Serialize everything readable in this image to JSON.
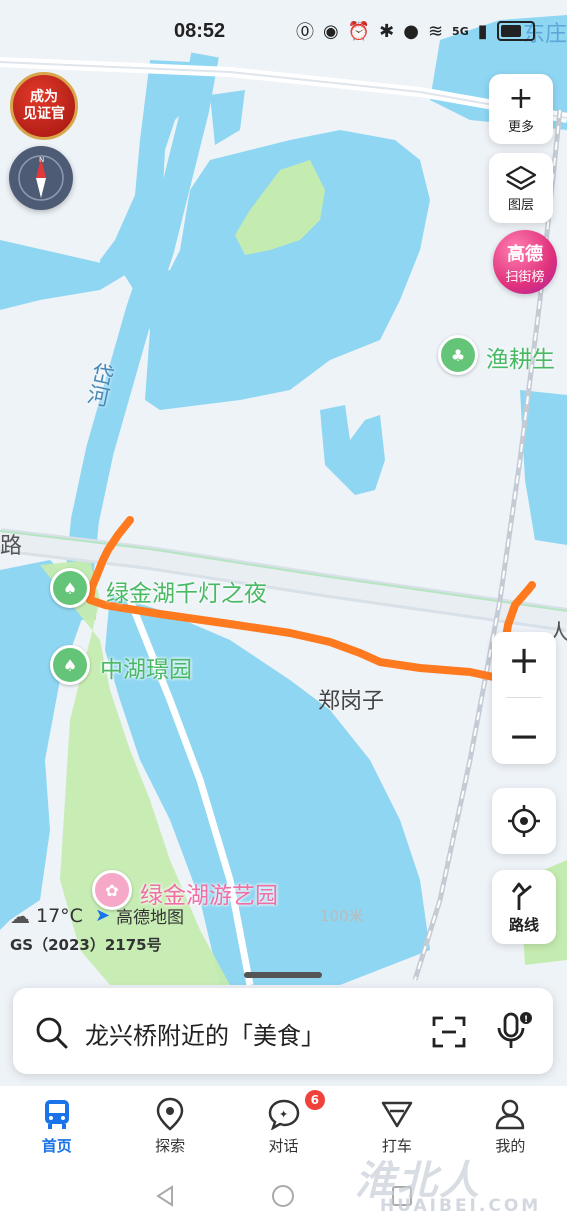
{
  "status": {
    "time": "08:52",
    "network": "5G"
  },
  "map": {
    "labels": {
      "daihe": "岱河",
      "road_left": "路",
      "road_right": "人",
      "dongzhuang": "东庄",
      "yugengsheng": "渔耕生",
      "lvjinhu_night": "绿金湖千灯之夜",
      "zhonghu": "中湖璟园",
      "zhenggangzi": "郑岗子",
      "lvjinhu_park": "绿金湖游艺园",
      "scale": "100米"
    },
    "route_color": "#ff7a1f",
    "water_color": "#8fd6f2",
    "greenery_color": "#c5ecb0"
  },
  "left_controls": {
    "badge": [
      "成为",
      "见证官"
    ]
  },
  "right_controls": {
    "more": "更多",
    "layers": "图层",
    "gaode_top": "高德",
    "gaode_bottom": "扫街榜",
    "route": "路线"
  },
  "weather": {
    "temp": "17°C",
    "brand": "高德地图"
  },
  "gs_number": "GS（2023）2175号",
  "search": {
    "text": "龙兴桥附近的「美食」"
  },
  "tabs": [
    {
      "label": "首页",
      "icon": "bus-icon"
    },
    {
      "label": "探索",
      "icon": "location-pin-icon"
    },
    {
      "label": "对话",
      "icon": "chat-icon",
      "count": "6"
    },
    {
      "label": "打车",
      "icon": "taxi-icon"
    },
    {
      "label": "我的",
      "icon": "user-icon"
    }
  ],
  "watermark": {
    "cn": "淮北人",
    "en": "HUAIBEI.COM"
  }
}
